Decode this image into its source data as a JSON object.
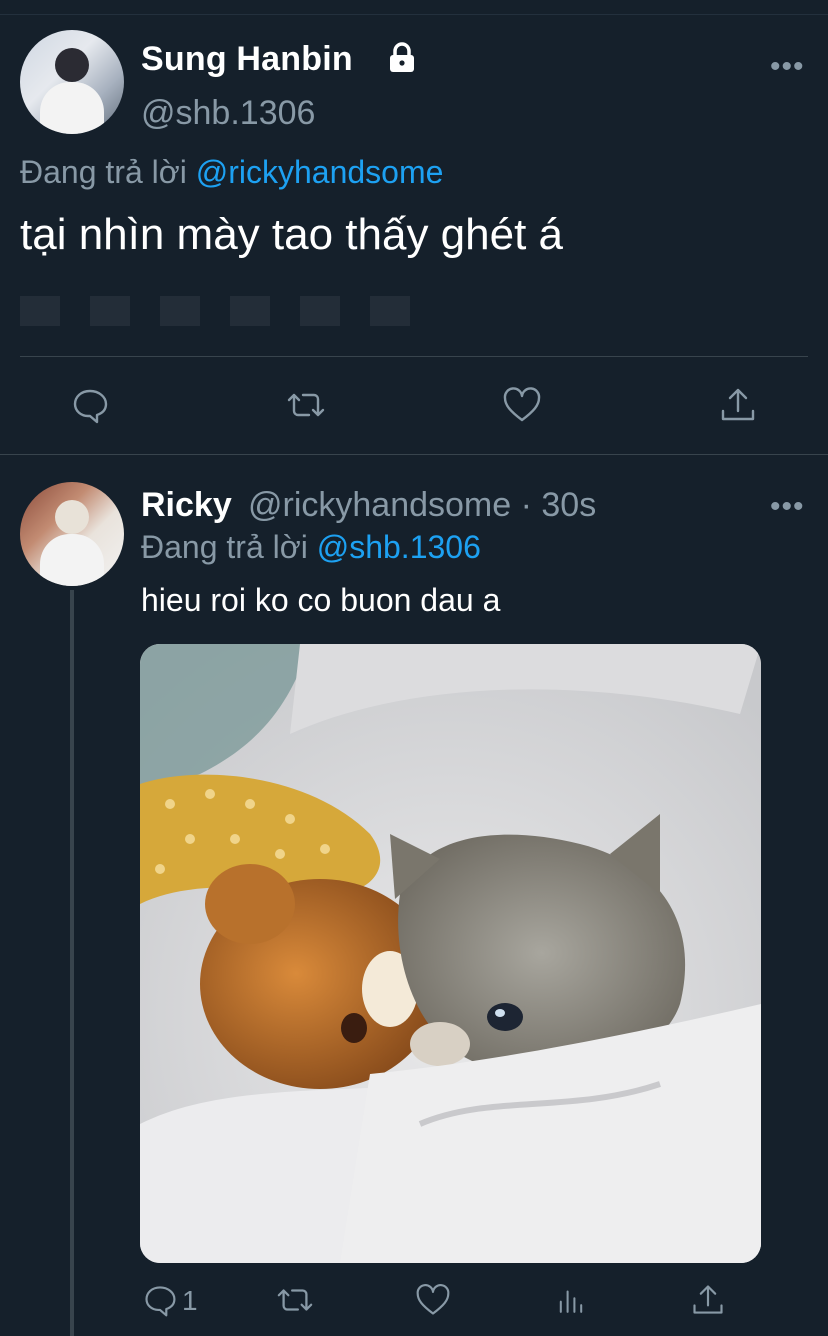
{
  "main_tweet": {
    "author_name": "Sung Hanbin",
    "handle": "@shb.1306",
    "replying_prefix": "Đang trả lời",
    "replying_to": "@rickyhandsome",
    "text": "tại nhìn mày tao thấy ghét á",
    "more_label": "•••",
    "locked_icon": "lock-icon"
  },
  "reply_tweet": {
    "author_name": "Ricky",
    "handle_time": "@rickyhandsome · 30s",
    "replying_prefix": "Đang trả lời",
    "replying_to": "@shb.1306",
    "text": "hieu roi ko co buon dau a",
    "more_label": "•••",
    "reply_count": "1",
    "media_description_icon": "image-crying-cat-with-teddy-bear"
  },
  "icons": [
    "reply-icon",
    "retweet-icon",
    "like-icon",
    "share-icon",
    "analytics-icon",
    "more-icon"
  ],
  "colors": {
    "background": "#15202b",
    "text": "#ffffff",
    "secondary": "#8899a6",
    "link": "#1da1f2",
    "divider": "#38444d"
  }
}
